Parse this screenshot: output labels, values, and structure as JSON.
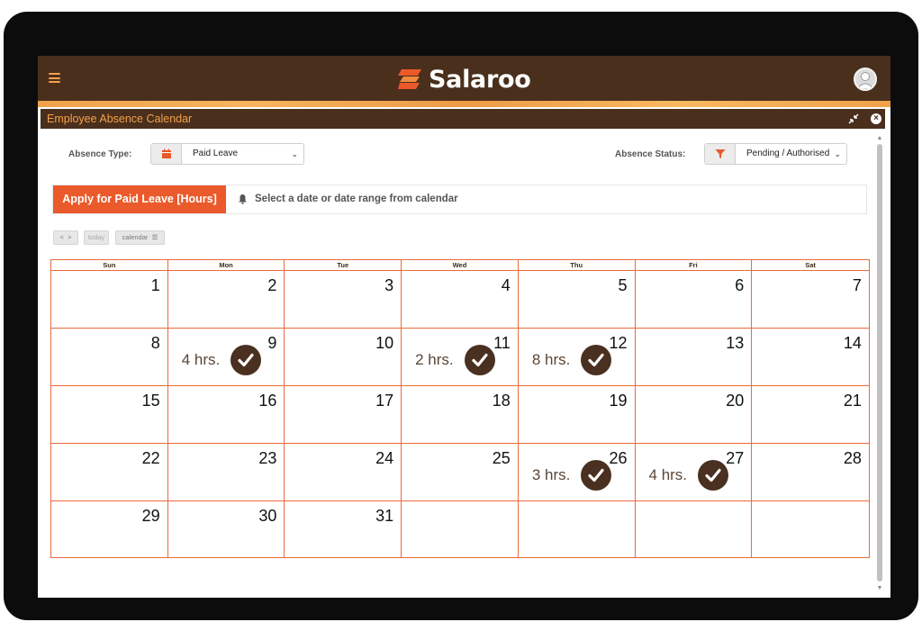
{
  "app": {
    "logo_text": "Salaroo"
  },
  "panel": {
    "title": "Employee Absence Calendar"
  },
  "filters": {
    "absence_type_label": "Absence Type:",
    "absence_type_value": "Paid Leave",
    "absence_status_label": "Absence Status:",
    "absence_status_value": "Pending / Authorised"
  },
  "apply": {
    "button_label": "Apply for Paid Leave [Hours]",
    "hint": "Select a date or date range from calendar"
  },
  "toolbar": {
    "prev": "<",
    "next": ">",
    "today": "today",
    "calendar": "calendar"
  },
  "calendar": {
    "weekdays": [
      "Sun",
      "Mon",
      "Tue",
      "Wed",
      "Thu",
      "Fri",
      "Sat"
    ],
    "weeks": [
      [
        {
          "day": "1"
        },
        {
          "day": "2"
        },
        {
          "day": "3"
        },
        {
          "day": "4"
        },
        {
          "day": "5"
        },
        {
          "day": "6"
        },
        {
          "day": "7"
        }
      ],
      [
        {
          "day": "8"
        },
        {
          "day": "9",
          "hours": "4 hrs."
        },
        {
          "day": "10"
        },
        {
          "day": "11",
          "hours": "2 hrs."
        },
        {
          "day": "12",
          "hours": "8 hrs."
        },
        {
          "day": "13"
        },
        {
          "day": "14"
        }
      ],
      [
        {
          "day": "15"
        },
        {
          "day": "16"
        },
        {
          "day": "17"
        },
        {
          "day": "18"
        },
        {
          "day": "19"
        },
        {
          "day": "20"
        },
        {
          "day": "21"
        }
      ],
      [
        {
          "day": "22"
        },
        {
          "day": "23"
        },
        {
          "day": "24"
        },
        {
          "day": "25"
        },
        {
          "day": "26",
          "hours": "3 hrs."
        },
        {
          "day": "27",
          "hours": "4 hrs."
        },
        {
          "day": "28"
        }
      ],
      [
        {
          "day": "29"
        },
        {
          "day": "30"
        },
        {
          "day": "31"
        },
        {
          "day": ""
        },
        {
          "day": ""
        },
        {
          "day": ""
        },
        {
          "day": ""
        }
      ]
    ]
  },
  "colors": {
    "brand_brown": "#4a2f1c",
    "accent_orange": "#ea5a2a",
    "grid_line": "#ea6a3c"
  },
  "icons": [
    "menu-icon",
    "salaroo-logo-icon",
    "user-avatar-icon",
    "compress-icon",
    "close-icon",
    "calendar-icon",
    "filter-icon",
    "bell-icon",
    "check-icon"
  ]
}
